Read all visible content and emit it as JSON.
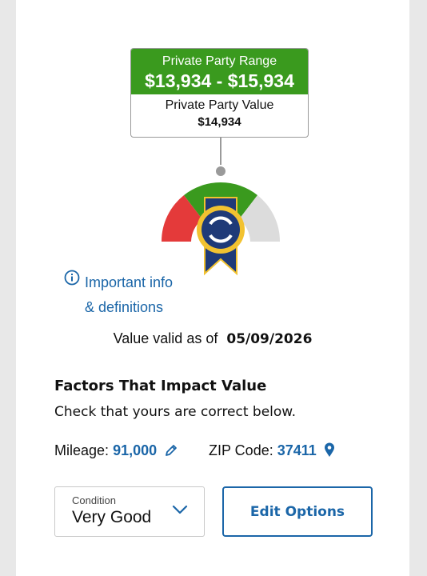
{
  "price_box": {
    "range_label": "Private Party Range",
    "range_value": "$13,934 - $15,934",
    "value_label": "Private Party Value",
    "value": "$14,934"
  },
  "gauge": {
    "colors": {
      "left": "#e43a3a",
      "middle": "#3a9a1e",
      "right": "#dcdcdc",
      "ribbon": "#1f3a78",
      "seal": "#f2c230"
    }
  },
  "info": {
    "icon": "info-circle-icon",
    "line1": "Important info",
    "line2": "& definitions"
  },
  "validity": {
    "label": "Value valid as of",
    "date": "05/09/2026"
  },
  "factors": {
    "title": "Factors That Impact Value",
    "subtitle": "Check that yours are correct below."
  },
  "mileage": {
    "label": "Mileage:",
    "value": "91,000",
    "icon": "pencil-icon"
  },
  "zip": {
    "label": "ZIP Code:",
    "value": "37411",
    "icon": "map-pin-icon"
  },
  "condition": {
    "label": "Condition",
    "value": "Very Good",
    "icon": "chevron-down-icon"
  },
  "edit_button": {
    "label": "Edit Options"
  },
  "colors": {
    "accent": "#1b66a8",
    "green": "#3a9a1e"
  }
}
